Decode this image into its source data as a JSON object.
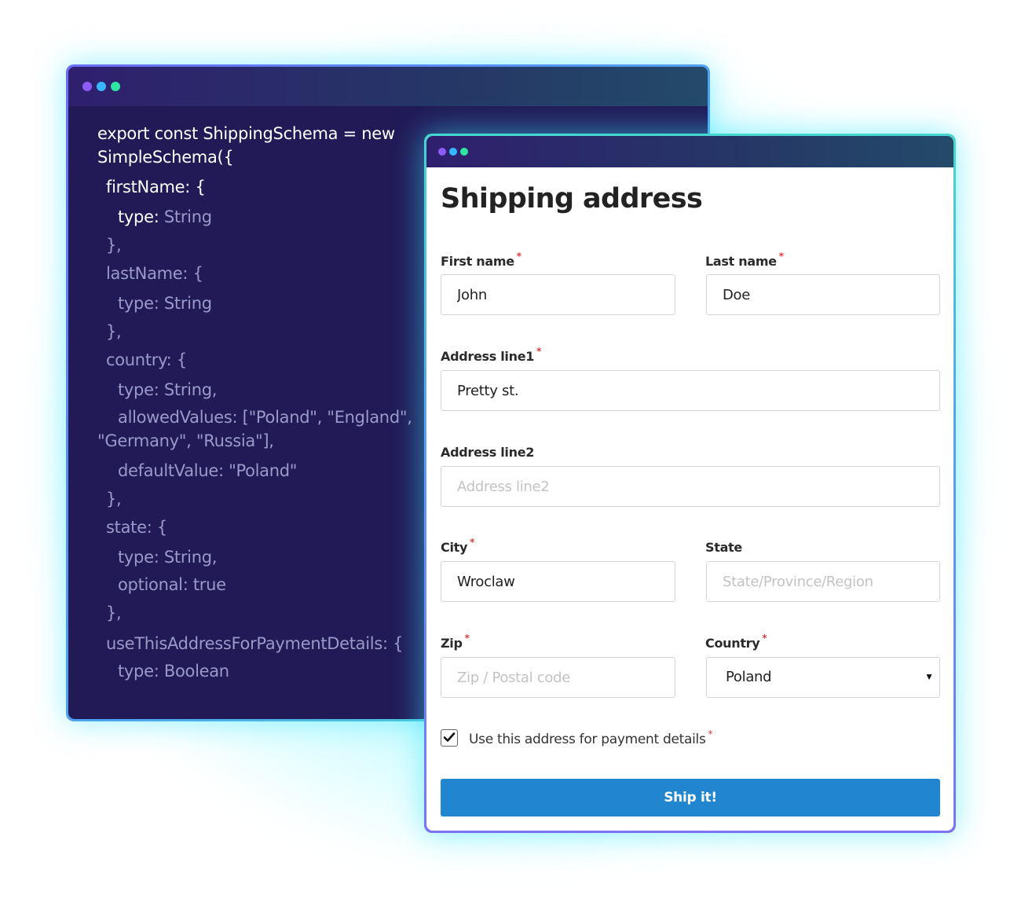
{
  "colors": {
    "dot_purple": "#8b5cf6",
    "dot_blue": "#37b7ff",
    "dot_green": "#2ee6a0",
    "code_bg": "#211a57",
    "button_bg": "#2185d0",
    "required_star": "#e03b3b"
  },
  "code_window": {
    "lines": [
      {
        "text": "export const ShippingSchema = new",
        "style": "k"
      },
      {
        "text": "SimpleSchema({",
        "style": "k"
      },
      {
        "text": "firstName: {",
        "style": "k"
      },
      {
        "text_key": "type: ",
        "text_val": "String",
        "style": "mix"
      },
      {
        "text": "},",
        "style": "d"
      },
      {
        "text": "lastName: {",
        "style": "d"
      },
      {
        "text": "type: String",
        "style": "d"
      },
      {
        "text": "},",
        "style": "d"
      },
      {
        "text": "country: {",
        "style": "d"
      },
      {
        "text": "type: String,",
        "style": "d"
      },
      {
        "text": "allowedValues: [\"Poland\", \"England\",",
        "style": "d"
      },
      {
        "text": "\"Germany\", \"Russia\"],",
        "style": "d"
      },
      {
        "text": "defaultValue: \"Poland\"",
        "style": "d"
      },
      {
        "text": "},",
        "style": "d"
      },
      {
        "text": "state: {",
        "style": "d"
      },
      {
        "text": "type: String,",
        "style": "d"
      },
      {
        "text": "optional: true",
        "style": "d"
      },
      {
        "text": "},",
        "style": "d"
      },
      {
        "text": "useThisAddressForPaymentDetails: {",
        "style": "d"
      },
      {
        "text": "type: Boolean",
        "style": "d"
      }
    ]
  },
  "form": {
    "title": "Shipping address",
    "required_mark": "*",
    "first_name": {
      "label": "First name",
      "value": "John",
      "placeholder": ""
    },
    "last_name": {
      "label": "Last name",
      "value": "Doe",
      "placeholder": ""
    },
    "address1": {
      "label": "Address line1",
      "value": "Pretty st.",
      "placeholder": ""
    },
    "address2": {
      "label": "Address line2",
      "value": "",
      "placeholder": "Address line2"
    },
    "city": {
      "label": "City",
      "value": "Wroclaw",
      "placeholder": ""
    },
    "state": {
      "label": "State",
      "value": "",
      "placeholder": "State/Province/Region"
    },
    "zip": {
      "label": "Zip",
      "value": "",
      "placeholder": "Zip / Postal code"
    },
    "country": {
      "label": "Country",
      "selected": "Poland"
    },
    "use_for_payment": {
      "label": "Use this address for payment details",
      "checked": true
    },
    "submit_label": "Ship it!"
  }
}
